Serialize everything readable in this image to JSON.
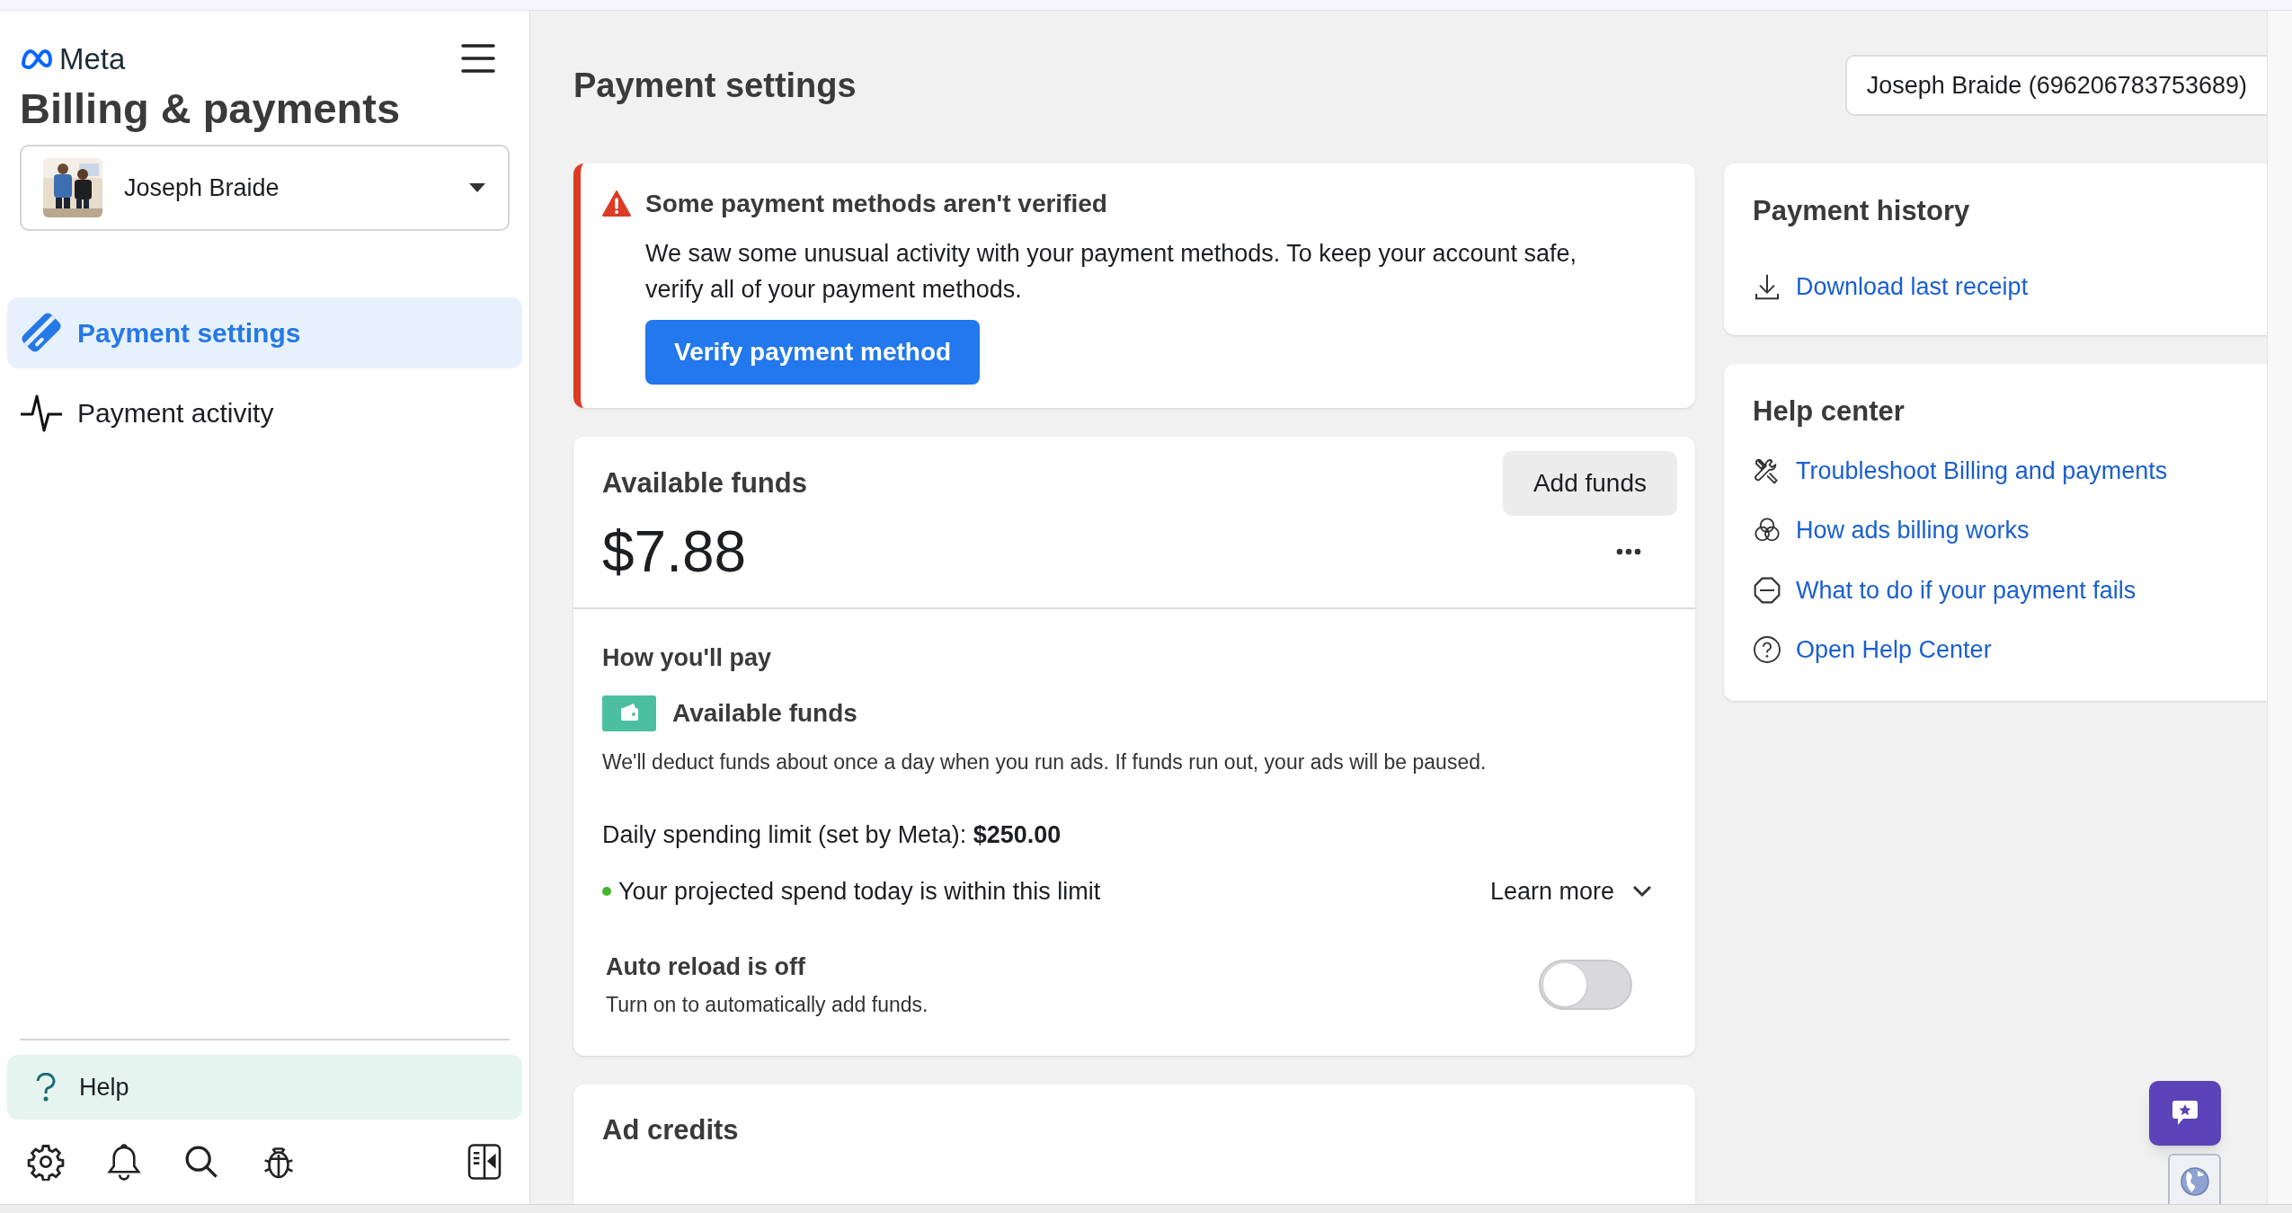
{
  "brand": {
    "name": "Meta"
  },
  "sidebar": {
    "title": "Billing & payments",
    "account": {
      "name": "Joseph Braide"
    },
    "nav": [
      {
        "label": "Payment settings",
        "selected": true,
        "kind": "card"
      },
      {
        "label": "Payment activity",
        "selected": false,
        "kind": "pulse"
      }
    ],
    "help": {
      "label": "Help"
    }
  },
  "page": {
    "title": "Payment settings",
    "account_selector": "Joseph Braide (696206783753689)"
  },
  "alert": {
    "title": "Some payment methods aren't verified",
    "message": "We saw some unusual activity with your payment methods. To keep your account safe, verify all of your payment methods.",
    "button": "Verify payment method"
  },
  "funds": {
    "title": "Available funds",
    "add_button": "Add funds",
    "amount": "$7.88",
    "how_title": "How you'll pay",
    "method": "Available funds",
    "note": "We'll deduct funds about once a day when you run ads. If funds run out, your ads will be paused.",
    "limit": "Daily spending limit (set by Meta): **$250.00**",
    "projected": "Your projected spend today is within this limit",
    "learn_more": "Learn more",
    "auto_reload": {
      "title": "Auto reload is off",
      "subtitle": "Turn on to automatically add funds.",
      "on": false
    }
  },
  "ad_credits": {
    "title": "Ad credits"
  },
  "payment_history": {
    "title": "Payment history",
    "links": [
      {
        "label": "Download last receipt",
        "kind": "download"
      }
    ]
  },
  "help_center": {
    "title": "Help center",
    "links": [
      {
        "label": "Troubleshoot Billing and payments",
        "kind": "tools"
      },
      {
        "label": "How ads billing works",
        "kind": "circles"
      },
      {
        "label": "What to do if your payment fails",
        "kind": "stop"
      },
      {
        "label": "Open Help Center",
        "kind": "question"
      }
    ]
  }
}
